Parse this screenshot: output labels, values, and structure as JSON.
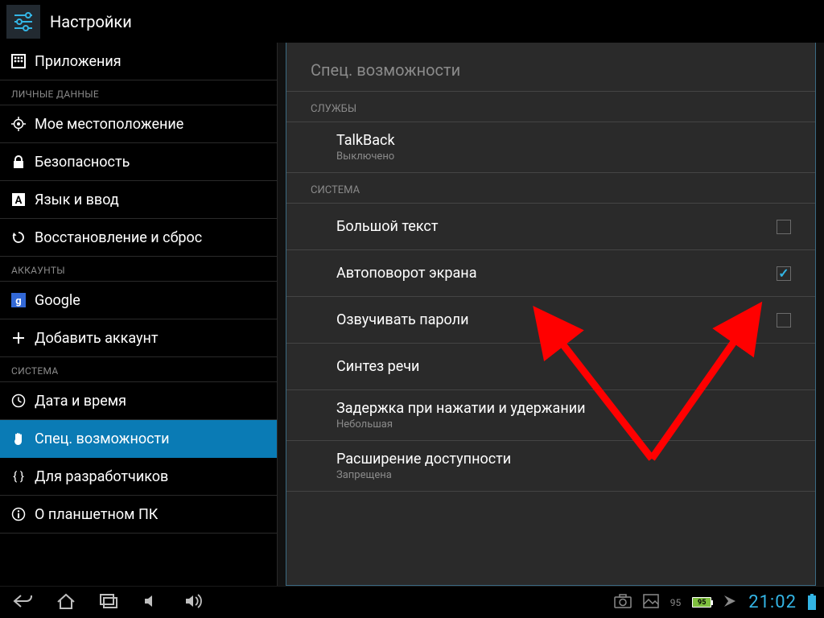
{
  "header": {
    "title": "Настройки"
  },
  "sidebar": {
    "top_item": {
      "label": "Приложения"
    },
    "cat_personal": "ЛИЧНЫЕ ДАННЫЕ",
    "personal": [
      {
        "label": "Мое местоположение"
      },
      {
        "label": "Безопасность"
      },
      {
        "label": "Язык и ввод"
      },
      {
        "label": "Восстановление и сброс"
      }
    ],
    "cat_accounts": "АККАУНТЫ",
    "accounts": [
      {
        "label": "Google"
      },
      {
        "label": "Добавить аккаунт"
      }
    ],
    "cat_system": "СИСТЕМА",
    "system": [
      {
        "label": "Дата и время"
      },
      {
        "label": "Спец. возможности",
        "selected": true
      },
      {
        "label": "Для разработчиков"
      },
      {
        "label": "О планшетном ПК"
      }
    ]
  },
  "content": {
    "title": "Спец. возможности",
    "services_label": "СЛУЖБЫ",
    "services": [
      {
        "title": "TalkBack",
        "sub": "Выключено"
      }
    ],
    "system_label": "СИСТЕМА",
    "system": [
      {
        "title": "Большой текст",
        "checkbox": true,
        "checked": false
      },
      {
        "title": "Автоповорот экрана",
        "checkbox": true,
        "checked": true
      },
      {
        "title": "Озвучивать пароли",
        "checkbox": true,
        "checked": false
      },
      {
        "title": "Синтез речи"
      },
      {
        "title": "Задержка при нажатии и удержании",
        "sub": "Небольшая"
      },
      {
        "title": "Расширение доступности",
        "sub": "Запрещена"
      }
    ]
  },
  "navbar": {
    "battery_pct": "95",
    "battery_badge": "95",
    "time": "21:02"
  },
  "annotation": {
    "arrow_color": "#ff0000"
  }
}
